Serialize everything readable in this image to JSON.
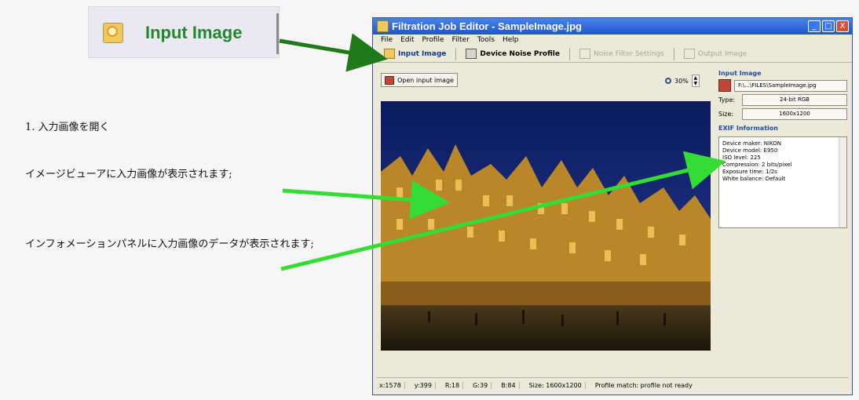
{
  "callout": {
    "label": "Input Image",
    "icon": "input-image-icon"
  },
  "annotations": {
    "step_title": "1. 入力画像を開く",
    "note_viewer": "イメージビューアに入力画像が表示されます;",
    "note_info": "インフォメーションパネルに入力画像のデータが表示されます;"
  },
  "window": {
    "title": "Filtration Job Editor - SampleImage.jpg",
    "buttons": [
      "_",
      "□",
      "X"
    ]
  },
  "menu": [
    "File",
    "Edit",
    "Profile",
    "Filter",
    "Tools",
    "Help"
  ],
  "tabs": [
    {
      "label": "Input Image",
      "state": "active"
    },
    {
      "label": "Device Noise Profile",
      "state": "normal"
    },
    {
      "label": "Noise Filter Settings",
      "state": "disabled"
    },
    {
      "label": "Output Image",
      "state": "disabled"
    }
  ],
  "viewer_toolbar": {
    "open_button": "Open input image",
    "zoom": "30%"
  },
  "info_panel": {
    "input_image_header": "Input Image",
    "file_path": "F:\\...\\FILES\\SampleImage.jpg",
    "type_label": "Type:",
    "type_value": "24-bit RGB",
    "size_label": "Size:",
    "size_value": "1600x1200",
    "exif_header": "EXIF Information",
    "exif_lines": [
      "Device maker: NIKON",
      "Device model: E950",
      "ISO level: 225",
      "Compression: 2 bits/pixel",
      "Exposure time: 1/2s",
      "White balance: Default"
    ]
  },
  "status": {
    "x": "x:1578",
    "y": "y:399",
    "r": "R:18",
    "g": "G:39",
    "b": "B:84",
    "size": "Size: 1600x1200",
    "profile": "Profile match: profile not ready"
  },
  "colors": {
    "accent_green": "#1e8a2e",
    "arrow_dark_green": "#1f7a1a",
    "arrow_light_green": "#33dd33",
    "title_blue": "#1c55cf"
  }
}
